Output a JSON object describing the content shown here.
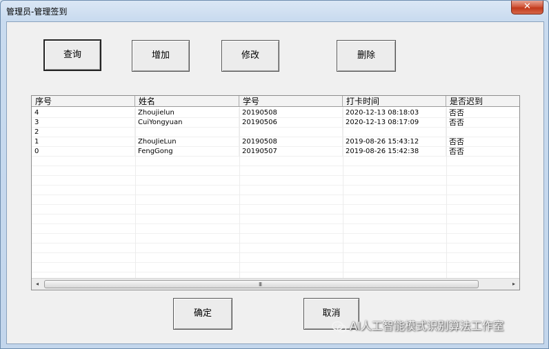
{
  "window": {
    "title": "管理员-管理签到",
    "close_glyph": "✕"
  },
  "toolbar": {
    "query_label": "查询",
    "add_label": "增加",
    "edit_label": "修改",
    "delete_label": "删除"
  },
  "grid": {
    "columns": [
      "序号",
      "姓名",
      "学号",
      "打卡时间",
      "是否迟到"
    ],
    "rows": [
      {
        "seq": "4",
        "name": "Zhoujielun",
        "sid": "20190508",
        "time": "2020-12-13 08:18:03",
        "late": "否否"
      },
      {
        "seq": "3",
        "name": "CuiYongyuan",
        "sid": "20190506",
        "time": "2020-12-13 08:17:09",
        "late": "否否"
      },
      {
        "seq": "2",
        "name": "",
        "sid": "",
        "time": "",
        "late": ""
      },
      {
        "seq": "1",
        "name": "ZhouJieLun",
        "sid": "20190508",
        "time": "2019-08-26 15:43:12",
        "late": "否否"
      },
      {
        "seq": "0",
        "name": "FengGong",
        "sid": "20190507",
        "time": "2019-08-26 15:42:38",
        "late": "否否"
      }
    ],
    "scroll_grip": "III",
    "scroll_left": "◂",
    "scroll_right": "▸"
  },
  "footer": {
    "ok_label": "确定",
    "cancel_label": "取消"
  },
  "watermark": {
    "text": "AI人工智能模式识别算法工作室"
  }
}
